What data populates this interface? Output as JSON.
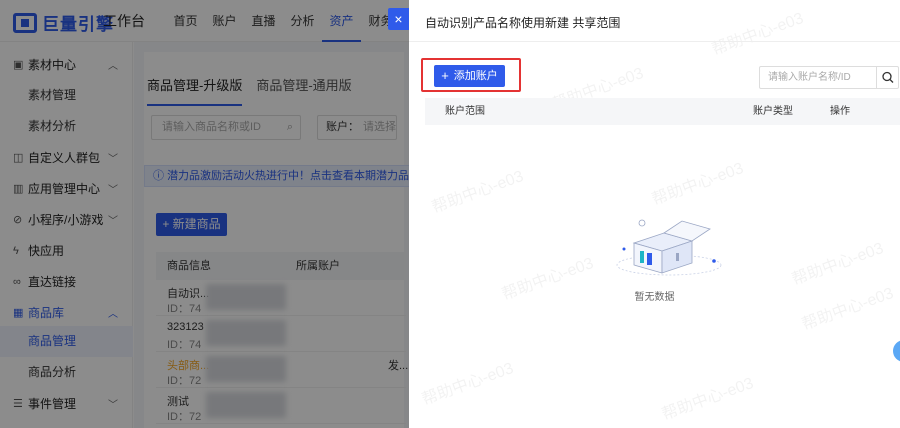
{
  "header": {
    "logo_text": "巨量引擎",
    "workbench": "工作台",
    "nav": [
      "首页",
      "账户",
      "直播",
      "分析",
      "资产",
      "财务"
    ],
    "active_nav_index": 4
  },
  "sidebar": {
    "items": [
      {
        "label": "素材中心",
        "icon": "video-icon",
        "chevron": "up"
      },
      {
        "label": "素材管理",
        "sub": true
      },
      {
        "label": "素材分析",
        "sub": true
      },
      {
        "label": "自定义人群包",
        "icon": "people-icon",
        "chevron": "down"
      },
      {
        "label": "应用管理中心",
        "icon": "app-icon",
        "chevron": "down"
      },
      {
        "label": "小程序/小游戏",
        "icon": "miniapp-icon",
        "chevron": "down"
      },
      {
        "label": "快应用",
        "icon": "quickapp-icon"
      },
      {
        "label": "直达链接",
        "icon": "link-icon"
      },
      {
        "label": "商品库",
        "icon": "grid-icon",
        "chevron": "up",
        "active": true
      },
      {
        "label": "商品管理",
        "sub": true,
        "active": true
      },
      {
        "label": "商品分析",
        "sub": true
      },
      {
        "label": "事件管理",
        "icon": "event-icon",
        "chevron": "down"
      }
    ]
  },
  "main": {
    "tabs": [
      "商品管理-升级版",
      "商品管理-通用版"
    ],
    "active_tab_index": 0,
    "search_placeholder": "请输入商品名称或ID",
    "account_filter_label": "账户：",
    "account_filter_placeholder": "请选择",
    "notice": "潜力品激励活动火热进行中！点击查看本期潜力品激励名单 了",
    "new_product_button": "+ 新建商品",
    "table_headers": [
      "商品信息",
      "所属账户"
    ],
    "rows": [
      {
        "line1": "自动识...",
        "line2": "ID：74"
      },
      {
        "line1": "323123",
        "line2": "ID：74"
      },
      {
        "line1": "头部商...",
        "line2": "ID：72",
        "tag": true,
        "trailing": "发..."
      },
      {
        "line1": "测试",
        "line2": "ID：72"
      },
      {
        "line1": "",
        "line2": "ID：72"
      }
    ]
  },
  "drawer": {
    "title": "自动识别产品名称使用新建 共享范围",
    "close_label": "×",
    "add_button": "添加账户",
    "add_button_icon": "+",
    "search_placeholder": "请输入账户名称/ID",
    "search_value": "",
    "table_headers": [
      "账户范围",
      "账户类型",
      "操作"
    ],
    "empty_text": "暂无数据",
    "watermark": "帮助中心-e03"
  },
  "colors": {
    "accent": "#2f5bea",
    "highlight": "#e43333",
    "mask": "rgba(0,0,0,0.45)"
  }
}
